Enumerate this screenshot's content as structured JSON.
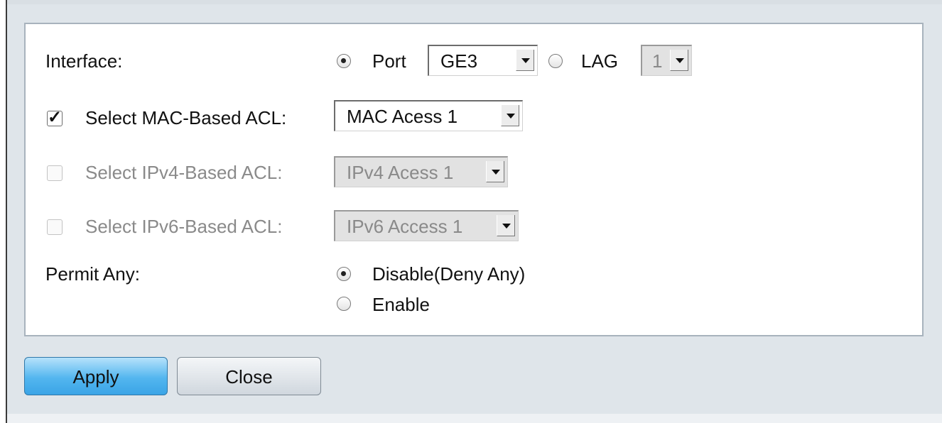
{
  "form": {
    "interface_label": "Interface:",
    "port_label": "Port",
    "port_value": "GE3",
    "lag_label": "LAG",
    "lag_value": "1",
    "mac_acl_label": "Select MAC-Based ACL:",
    "mac_acl_value": "MAC Acess 1",
    "ipv4_acl_label": "Select IPv4-Based ACL:",
    "ipv4_acl_value": "IPv4 Acess 1",
    "ipv6_acl_label": "Select IPv6-Based ACL:",
    "ipv6_acl_value": "IPv6 Access 1",
    "permit_any_label": "Permit Any:",
    "disable_label": "Disable(Deny Any)",
    "enable_label": "Enable",
    "mac_checked_glyph": "✓"
  },
  "buttons": {
    "apply": "Apply",
    "close": "Close"
  }
}
